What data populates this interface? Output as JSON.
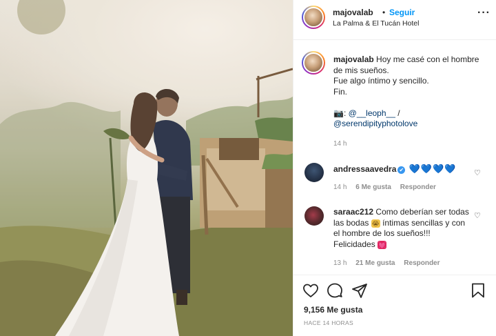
{
  "post": {
    "username": "majovalab",
    "dot": "•",
    "follow_label": "Seguir",
    "location": "La Palma & El Tucán Hotel",
    "more_icon": "ellipsis-icon"
  },
  "caption": {
    "username": "majovalab",
    "line1": "Hoy me casé con el hombre de mis sueños.",
    "line2": "Fue algo íntimo y sencillo.",
    "line3": "Fin.",
    "camera_icon": "📷",
    "credit_sep": ":",
    "credit1": "@__leoph__",
    "credit_slash": "/",
    "credit2": "@serendipityphotolove",
    "time": "14 h"
  },
  "comments": [
    {
      "username": "andressaavedra",
      "verified": "✔",
      "text": "💙💙💙💙",
      "time": "14 h",
      "likes": "6 Me gusta",
      "reply": "Responder"
    },
    {
      "username": "saraac212",
      "text_a": "Como deberían ser todas las bodas",
      "emoji_a": "😭",
      "text_b": "íntimas sencillas y con el hombre de los sueños!!! Felicidades",
      "emoji_b": "💓",
      "time": "13 h",
      "likes": "21 Me gusta",
      "reply": "Responder"
    }
  ],
  "footer": {
    "likes": "9,156 Me gusta",
    "ago": "HACE 14 HORAS"
  },
  "colors": {
    "link": "#0095f6",
    "mention": "#00376b",
    "muted": "#8e8e8e"
  }
}
